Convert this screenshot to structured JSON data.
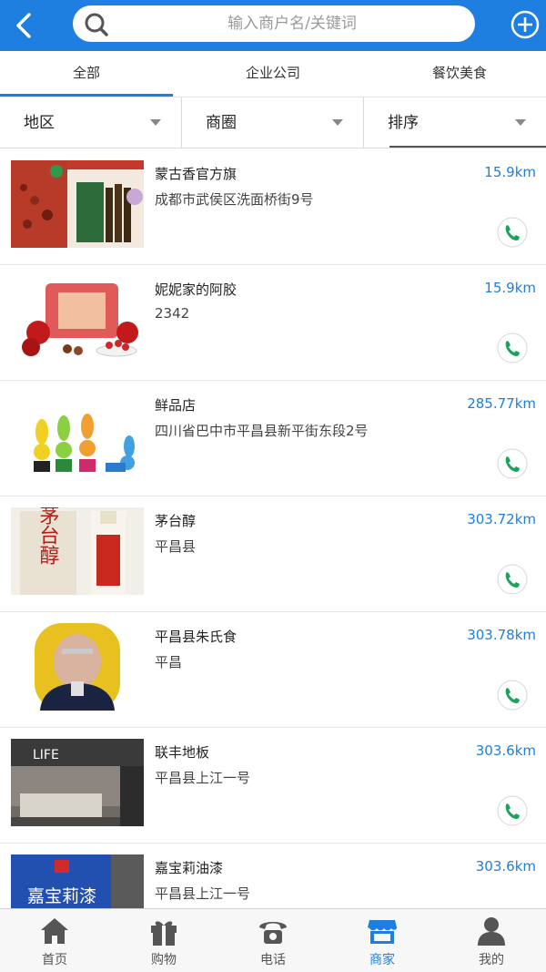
{
  "header": {
    "search_placeholder": "输入商户名/关键词",
    "back_icon": "back-arrow-icon",
    "add_icon": "plus-circle-icon"
  },
  "tabs": [
    {
      "label": "全部",
      "active": true
    },
    {
      "label": "企业公司",
      "active": false
    },
    {
      "label": "餐饮美食",
      "active": false
    }
  ],
  "filters": [
    {
      "label": "地区"
    },
    {
      "label": "商圈"
    },
    {
      "label": "排序"
    }
  ],
  "merchants": [
    {
      "name": "蒙古香官方旗",
      "address": "成都市武侯区洗面桥街9号",
      "distance": "15.9km"
    },
    {
      "name": "妮妮家的阿胶",
      "address": "2342",
      "distance": "15.9km"
    },
    {
      "name": "鲜品店",
      "address": "四川省巴中市平昌县新平街东段2号",
      "distance": "285.77km"
    },
    {
      "name": "茅台醇",
      "address": "平昌县",
      "distance": "303.72km"
    },
    {
      "name": "平昌县朱氏食",
      "address": "平昌",
      "distance": "303.78km"
    },
    {
      "name": "联丰地板",
      "address": "平昌县上江一号",
      "distance": "303.6km"
    },
    {
      "name": "嘉宝莉油漆",
      "address": "平昌县上江一号",
      "distance": "303.6km"
    }
  ],
  "thumb_text": {
    "maotai": "茅台醇",
    "life": "LIFE",
    "jiabaoli": "嘉宝莉漆"
  },
  "bottom_nav": [
    {
      "label": "首页",
      "icon": "home-icon",
      "active": false
    },
    {
      "label": "购物",
      "icon": "gift-icon",
      "active": false
    },
    {
      "label": "电话",
      "icon": "phone-icon",
      "active": false
    },
    {
      "label": "商家",
      "icon": "store-icon",
      "active": true
    },
    {
      "label": "我的",
      "icon": "user-icon",
      "active": false
    }
  ],
  "colors": {
    "accent": "#1e7fe0",
    "call_green": "#1aa35a"
  }
}
